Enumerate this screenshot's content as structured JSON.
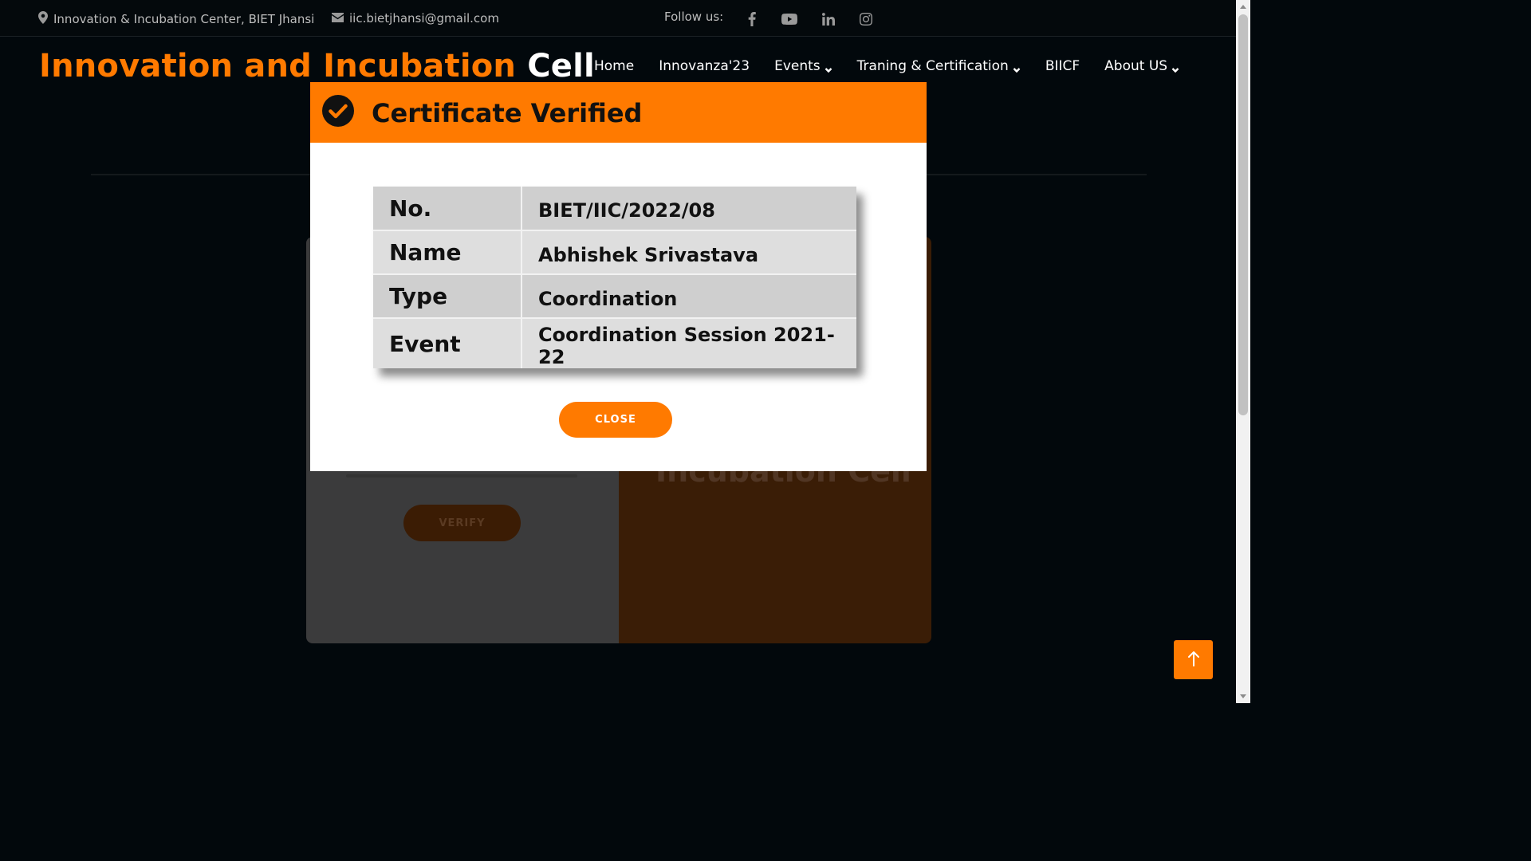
{
  "topbar": {
    "location": "Innovation & Incubation Center, BIET Jhansi",
    "email": "iic.bietjhansi@gmail.com",
    "follow_label": "Follow us:",
    "social_icons": [
      "facebook-icon",
      "youtube-icon",
      "linkedin-icon",
      "instagram-icon"
    ]
  },
  "header": {
    "brand_orange": "Innovation and Incubation",
    "brand_white": "Cell",
    "nav": [
      {
        "label": "Home"
      },
      {
        "label": "Innovanza'23"
      },
      {
        "label": "Events",
        "dropdown": true
      },
      {
        "label": "Traning & Certification",
        "dropdown": true
      },
      {
        "label": "BIICF"
      },
      {
        "label": "About US",
        "dropdown": true
      }
    ]
  },
  "background_card": {
    "verify_label": "VERIFY",
    "right_text": "Incubation Cell"
  },
  "modal": {
    "title": "Certificate Verified",
    "rows": [
      {
        "key": "No.",
        "value": "BIET/IIC/2022/08"
      },
      {
        "key": "Name",
        "value": "Abhishek Srivastava"
      },
      {
        "key": "Type",
        "value": "Coordination"
      },
      {
        "key": "Event",
        "value": "Coordination Session 2021-22"
      }
    ],
    "close_label": "CLOSE"
  },
  "colors": {
    "accent": "#ff7a00",
    "background": "#02080c"
  }
}
